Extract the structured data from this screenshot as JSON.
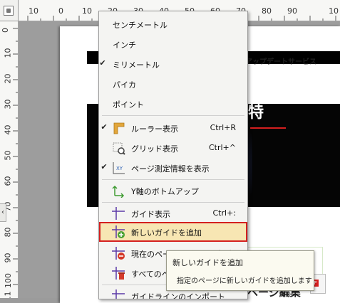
{
  "ruler": {
    "h_labels": [
      "10",
      "0",
      "10",
      "20",
      "30",
      "40",
      "50",
      "60",
      "70",
      "80",
      "90",
      "10"
    ],
    "v_labels": [
      "0",
      "10",
      "20",
      "30",
      "40",
      "50",
      "60",
      "70",
      "80",
      "90",
      "100",
      "11"
    ]
  },
  "page": {
    "nav_text": "商品・アップデートサービス",
    "hero_title": "特"
  },
  "bottom_card": {
    "label": "ページ編集"
  },
  "menu": {
    "items": [
      {
        "label": "センチメートル",
        "checked": false,
        "icon": null,
        "shortcut": ""
      },
      {
        "label": "インチ",
        "checked": false,
        "icon": null,
        "shortcut": ""
      },
      {
        "label": "ミリメートル",
        "checked": true,
        "icon": null,
        "shortcut": ""
      },
      {
        "label": "パイカ",
        "checked": false,
        "icon": null,
        "shortcut": ""
      },
      {
        "label": "ポイント",
        "checked": false,
        "icon": null,
        "shortcut": ""
      },
      {
        "label": "ルーラー表示",
        "checked": true,
        "icon": "ruler-icon",
        "shortcut": "Ctrl+R"
      },
      {
        "label": "グリッド表示",
        "checked": false,
        "icon": "grid-icon",
        "shortcut": "Ctrl+^"
      },
      {
        "label": "ページ測定情報を表示",
        "checked": true,
        "icon": "xy-measure-icon",
        "shortcut": ""
      },
      {
        "label": "Y軸のボトムアップ",
        "checked": false,
        "icon": "y-axis-bottom-up-icon",
        "shortcut": ""
      },
      {
        "label": "ガイド表示",
        "checked": false,
        "icon": "guide-icon",
        "shortcut": "Ctrl+:"
      },
      {
        "label": "新しいガイドを追加",
        "checked": false,
        "icon": "add-guide-icon",
        "shortcut": ""
      },
      {
        "label": "現在のページのガイドを削除",
        "checked": false,
        "icon": "delete-guide-icon",
        "shortcut": ""
      },
      {
        "label": "すべてのページのガイドを削除",
        "checked": false,
        "icon": "delete-all-guides-icon",
        "shortcut": ""
      },
      {
        "label": "ガイドラインのインポート",
        "checked": false,
        "icon": "import-guides-icon",
        "shortcut": ""
      }
    ],
    "highlighted_index": 10
  },
  "tooltip": {
    "title": "新しいガイドを追加",
    "description": "指定のページに新しいガイドを追加します"
  },
  "colors": {
    "highlight_border": "#d42020",
    "highlight_fill": "#f7e6b3",
    "guide_purple": "#5b3aa8",
    "add_green": "#4aa132",
    "delete_red": "#d43a2a"
  }
}
